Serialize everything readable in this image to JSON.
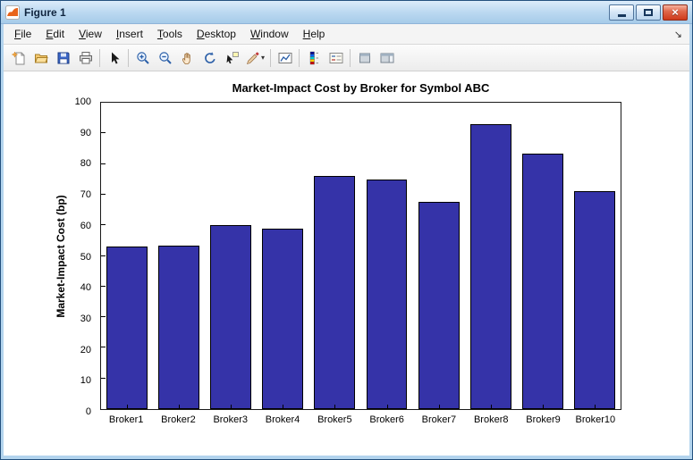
{
  "window": {
    "title": "Figure 1",
    "controls": [
      "minimize",
      "maximize",
      "close"
    ]
  },
  "menubar": {
    "items": [
      "File",
      "Edit",
      "View",
      "Insert",
      "Tools",
      "Desktop",
      "Window",
      "Help"
    ],
    "dock_arrow": "↘"
  },
  "toolbar": {
    "items": [
      "new-figure",
      "open-file",
      "save-figure",
      "print-figure",
      "separator",
      "edit-plot",
      "separator",
      "zoom-in",
      "zoom-out",
      "pan",
      "rotate-3d",
      "data-cursor",
      "brush",
      "separator",
      "link-plot",
      "separator",
      "insert-colorbar",
      "insert-legend",
      "separator",
      "hide-plot-tools",
      "show-plot-tools"
    ]
  },
  "chart_data": {
    "type": "bar",
    "title": "Market-Impact Cost by Broker for Symbol ABC",
    "categories": [
      "Broker1",
      "Broker2",
      "Broker3",
      "Broker4",
      "Broker5",
      "Broker6",
      "Broker7",
      "Broker8",
      "Broker9",
      "Broker10"
    ],
    "values": [
      53,
      53.5,
      60,
      59,
      76,
      75,
      67.5,
      93,
      83.5,
      71
    ],
    "xlabel": "",
    "ylabel": "Market-Impact Cost (bp)",
    "ylim": [
      0,
      100
    ],
    "yticks": [
      0,
      10,
      20,
      30,
      40,
      50,
      60,
      70,
      80,
      90,
      100
    ],
    "bar_color": "#3533a8",
    "bar_edge_color": "#000000",
    "grid": false,
    "legend_visible": false
  }
}
